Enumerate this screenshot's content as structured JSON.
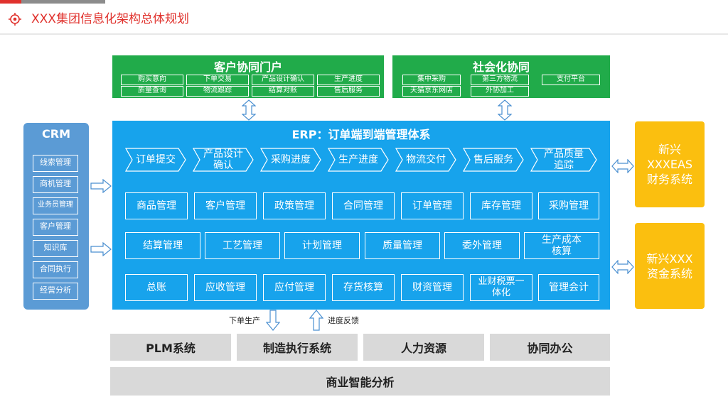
{
  "header": {
    "title": "XXX集团信息化架构总体规划",
    "icon": "target-icon",
    "accent": "#e0312c"
  },
  "customer_portal": {
    "title": "客户协同门户",
    "items": [
      "购买意向",
      "下单交易",
      "产品设计确认",
      "生产进度",
      "质量查询",
      "物流跟踪",
      "结算对账",
      "售后服务"
    ]
  },
  "social_collab": {
    "title": "社会化协同",
    "items": [
      "集中采购",
      "第三方物流",
      "支付平台",
      "天猫京东网店",
      "外协加工"
    ]
  },
  "erp": {
    "title": "ERP：订单端到端管理体系",
    "flow": [
      "订单提交",
      "产品设计\n确认",
      "采购进度",
      "生产进度",
      "物流交付",
      "售后服务",
      "产品质量\n追踪"
    ],
    "row1": [
      "商品管理",
      "客户管理",
      "政策管理",
      "合同管理",
      "订单管理",
      "库存管理",
      "采购管理"
    ],
    "row2": [
      "结算管理",
      "工艺管理",
      "计划管理",
      "质量管理",
      "委外管理",
      "生产成本\n核算"
    ],
    "row3": [
      "总账",
      "应收管理",
      "应付管理",
      "存货核算",
      "财资管理",
      "业财税票一\n体化",
      "管理会计"
    ]
  },
  "crm": {
    "title": "CRM",
    "items": [
      "线索管理",
      "商机管理",
      "业务员管理",
      "客户管理",
      "知识库",
      "合同执行",
      "经营分析"
    ]
  },
  "finance": {
    "eas": "新兴\nXXXEAS\n财务系统",
    "fund": "新兴XXX\n资金系统"
  },
  "arrows": {
    "down_label": "下单生产",
    "up_label": "进度反馈"
  },
  "systems": [
    "PLM系统",
    "制造执行系统",
    "人力资源",
    "协同办公"
  ],
  "bi": "商业智能分析",
  "colors": {
    "green": "#21ab4a",
    "blue": "#17a3ec",
    "crm": "#5b9bd5",
    "yellow": "#fbbf0f",
    "gray": "#d9d9d9"
  }
}
